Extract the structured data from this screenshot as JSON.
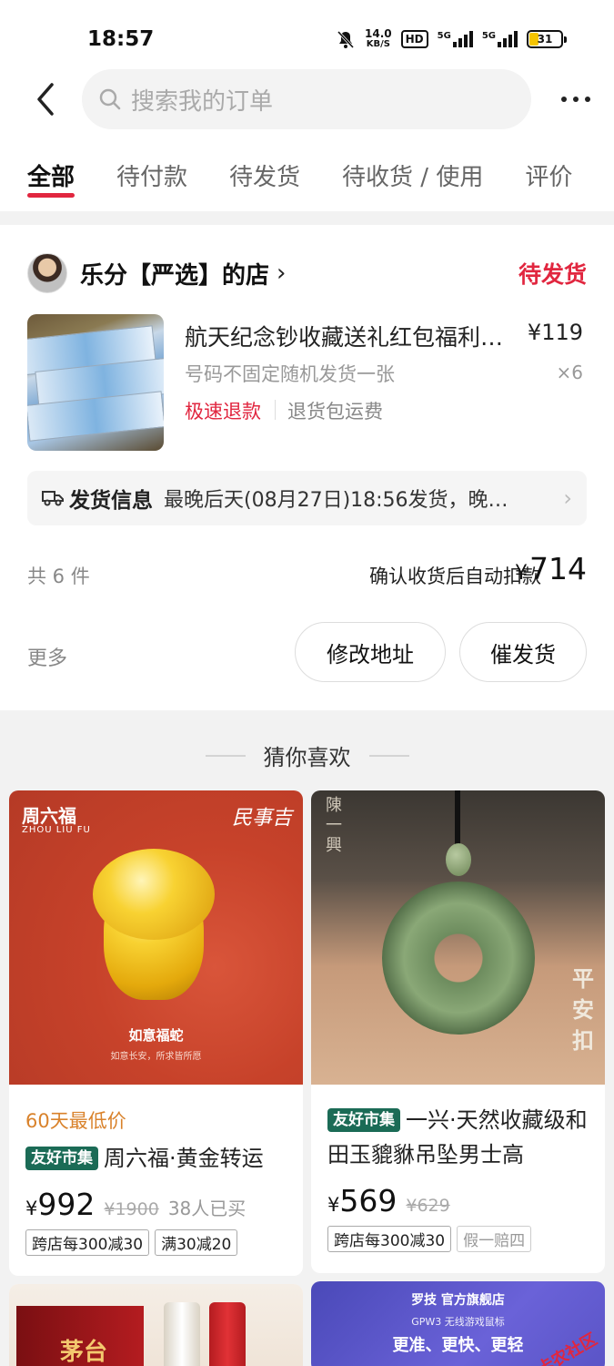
{
  "status_bar": {
    "time": "18:57",
    "net_speed_value": "14.0",
    "net_speed_unit": "KB/S",
    "hd_label": "HD",
    "signal_1_label": "5G",
    "signal_2_label": "5G",
    "battery": "31",
    "icons": [
      "mute-bell-icon",
      "hd-icon",
      "signal-icon",
      "signal-icon",
      "battery-icon"
    ]
  },
  "header": {
    "search_placeholder": "搜索我的订单",
    "icons": [
      "back-icon",
      "search-icon",
      "more-icon"
    ]
  },
  "tabs": [
    {
      "label": "全部",
      "active": true
    },
    {
      "label": "待付款"
    },
    {
      "label": "待发货"
    },
    {
      "label": "待收货 / 使用"
    },
    {
      "label": "评价"
    }
  ],
  "order": {
    "shop_name": "乐分【严选】的店",
    "shop_chevron": "›",
    "status": "待发货",
    "product_title": "航天纪念钞收藏送礼红包福利…",
    "price": "¥119",
    "spec": "号码不固定随机发货一张",
    "quantity": "×6",
    "tag_refund": "极速退款",
    "tag_shipping": "退货包运费",
    "shipping_label": "发货信息",
    "shipping_text": "最晚后天(08月27日)18:56发货，晚…",
    "count_text": "共 6 件",
    "total_label": "确认收货后自动扣款",
    "total_yen": "¥",
    "total_value": "714",
    "more_label": "更多",
    "btn_change_address": "修改地址",
    "btn_urge": "催发货"
  },
  "recommend": {
    "title": "猜你喜欢",
    "items": [
      {
        "brand": "周六福",
        "brand_en": "ZHOU LIU FU",
        "brand_logo": "民事吉",
        "image_caption": "如意福蛇",
        "image_subcaption": "如意长安，所求皆所愿",
        "low_price_tag": "60天最低价",
        "market_tag": "友好市集",
        "title": "周六福·黄金转运",
        "price_yen": "¥",
        "price": "992",
        "old_price": "¥1900",
        "sold": "38人已买",
        "promos": [
          "跨店每300减30",
          "满30减20"
        ]
      },
      {
        "seal_text": "陳一興",
        "side_text": "平安扣",
        "market_tag": "友好市集",
        "title": "一兴·天然收藏级和田玉貔貅吊坠男士高",
        "price_yen": "¥",
        "price": "569",
        "old_price": "¥629",
        "promos": [
          "跨店每300减30",
          "假一赔四"
        ]
      },
      {
        "box_text": "茅台"
      },
      {
        "brand": "罗技 官方旗舰店",
        "subtitle": "GPW3 无线游戏鼠标",
        "slogan": "更准、更快、更轻",
        "watermark": "卡农社区"
      }
    ]
  },
  "colors": {
    "accent": "#e1263f",
    "market_tag": "#1b6b56",
    "low_price": "#d9822b"
  }
}
